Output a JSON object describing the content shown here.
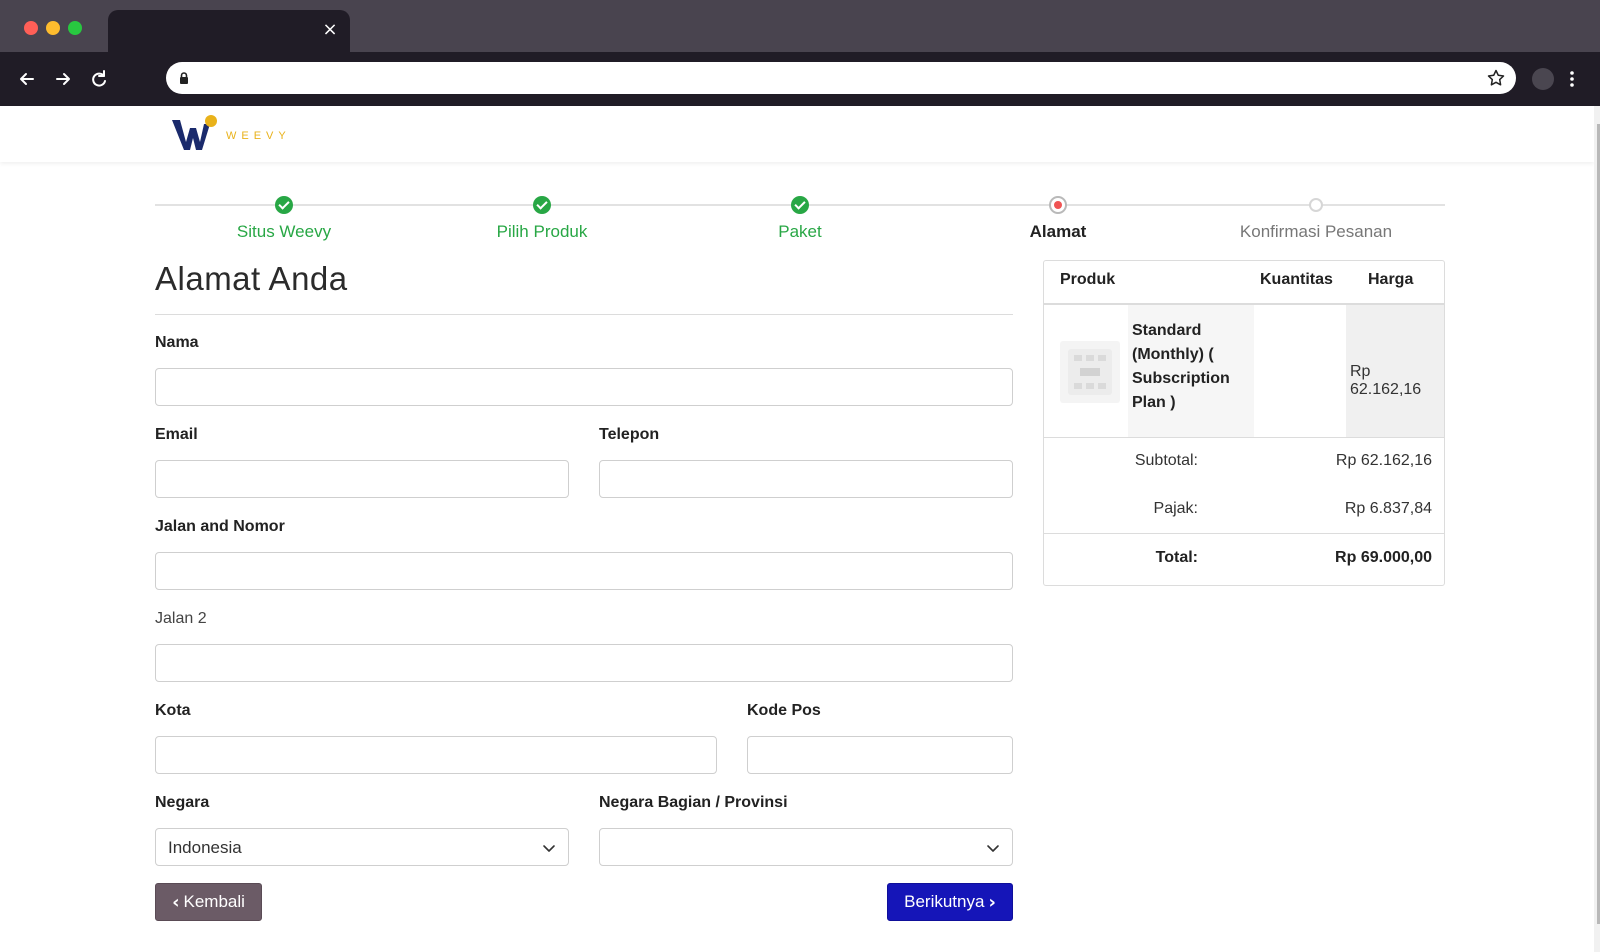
{
  "browser": {
    "tab_close_glyph": "×"
  },
  "brand": {
    "logo_text": "WEEVY",
    "colors": {
      "navy": "#1a2a6c",
      "gold": "#e9b21a"
    }
  },
  "progress": {
    "steps": [
      {
        "label": "Situs Weevy",
        "state": "done"
      },
      {
        "label": "Pilih Produk",
        "state": "done"
      },
      {
        "label": "Paket",
        "state": "done"
      },
      {
        "label": "Alamat",
        "state": "current"
      },
      {
        "label": "Konfirmasi Pesanan",
        "state": "todo"
      }
    ]
  },
  "form": {
    "title": "Alamat Anda",
    "labels": {
      "name": "Nama",
      "email": "Email",
      "phone": "Telepon",
      "street": "Jalan and Nomor",
      "street2": "Jalan 2",
      "city": "Kota",
      "zip": "Kode Pos",
      "country": "Negara",
      "state": "Negara Bagian / Provinsi"
    },
    "values": {
      "name": "",
      "email": "",
      "phone": "",
      "street": "",
      "street2": "",
      "city": "",
      "zip": "",
      "country": "Indonesia",
      "state": ""
    },
    "buttons": {
      "back": "Kembali",
      "next": "Berikutnya"
    }
  },
  "summary": {
    "headers": {
      "product": "Produk",
      "quantity": "Kuantitas",
      "price": "Harga"
    },
    "item": {
      "name": "Standard (Monthly) ( Subscription Plan )",
      "quantity": "",
      "price": "Rp 62.162,16"
    },
    "subtotal_label": "Subtotal:",
    "subtotal": "Rp 62.162,16",
    "tax_label": "Pajak:",
    "tax": "Rp 6.837,84",
    "total_label": "Total:",
    "total": "Rp 69.000,00"
  },
  "icons": {
    "back": "arrow-left-icon",
    "forward": "arrow-right-icon",
    "reload": "reload-icon",
    "lock": "lock-icon",
    "bookmark": "star-icon",
    "menu": "kebab-menu-icon",
    "dropdown": "chevron-down-icon"
  }
}
